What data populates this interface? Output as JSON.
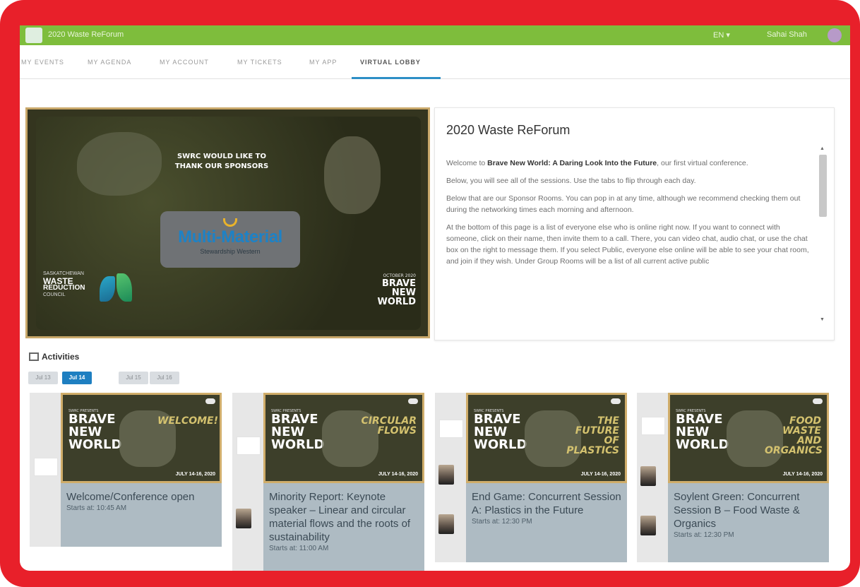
{
  "topbar": {
    "brand": "2020 Waste ReForum",
    "lang": "EN ▾",
    "user": "Sahai Shah"
  },
  "tabs": [
    {
      "label": "MY EVENTS"
    },
    {
      "label": "MY AGENDA"
    },
    {
      "label": "MY ACCOUNT"
    },
    {
      "label": "MY TICKETS"
    },
    {
      "label": "MY APP"
    },
    {
      "label": "VIRTUAL LOBBY"
    }
  ],
  "hero": {
    "thank_you": "SWRC WOULD LIKE TO THANK OUR SPONSORS",
    "sponsor_name": "Multi-Material",
    "sponsor_sub": "Stewardship Western",
    "council_line1": "SASKATCHEWAN",
    "council_line2": "WASTE",
    "council_line3": "REDUCTION",
    "council_line4": "COUNCIL",
    "brave_dates": "OCTOBER 2020",
    "brave_line1": "BRAVE",
    "brave_line2": "NEW",
    "brave_line3": "WORLD"
  },
  "info": {
    "title": "2020 Waste ReForum",
    "p1_before": "Welcome to ",
    "p1_bold": "Brave New World: A Daring Look Into the Future",
    "p1_after": ", our first virtual conference.",
    "p2": "Below, you will see all of the sessions. Use the tabs to flip through each day.",
    "p3": "Below that are our Sponsor Rooms. You can pop in at any time, although we recommend checking them out during the networking times each morning and afternoon.",
    "p4": "At the bottom of this page is a list of everyone else who is online right now. If you want to connect with someone, click on their name, then invite them to a call. There, you can video chat, audio chat, or use the chat box on the right to message them. If you select Public, everyone else online will be able to see your chat room, and join if they wish. Under Group Rooms will be a list of all current active public",
    "scroll_up": "▲",
    "scroll_down": "▼"
  },
  "activities": {
    "heading": "Activities",
    "days": [
      {
        "label": "Jul 13"
      },
      {
        "label": "Jul 14"
      },
      {
        "label": "Jul 15"
      },
      {
        "label": "Jul 16"
      }
    ],
    "cards": [
      {
        "title": "Welcome/Conference open",
        "starts": "Starts at: 10:45 AM",
        "thumb_sub": "WELCOME!",
        "thumb_date": "JULY 14-16, 2020"
      },
      {
        "title": "Minority Report: Keynote speaker – Linear and circular material flows and the roots of sustainability",
        "starts": "Starts at: 11:00 AM",
        "thumb_sub": "CIRCULAR FLOWS",
        "thumb_date": "JULY 14-16, 2020"
      },
      {
        "title": "End Game: Concurrent Session A: Plastics in the Future",
        "starts": "Starts at: 12:30 PM",
        "thumb_sub": "THE FUTURE OF PLASTICS",
        "thumb_date": "JULY 14-16, 2020"
      },
      {
        "title": "Soylent Green: Concurrent Session B – Food Waste & Organics",
        "starts": "Starts at: 12:30 PM",
        "thumb_sub": "FOOD WASTE AND ORGANICS",
        "thumb_date": "JULY 14-16, 2020"
      }
    ],
    "brave": {
      "l1": "BRAVE",
      "l2": "NEW",
      "l3": "WORLD",
      "small": "SWRC PRESENTS"
    }
  },
  "colors": {
    "frame": "#e8202a",
    "topbar": "#7ebd3c",
    "tab_accent": "#2d8fc6",
    "day_active": "#1e7fc1",
    "card_meta": "#aebbc3"
  }
}
